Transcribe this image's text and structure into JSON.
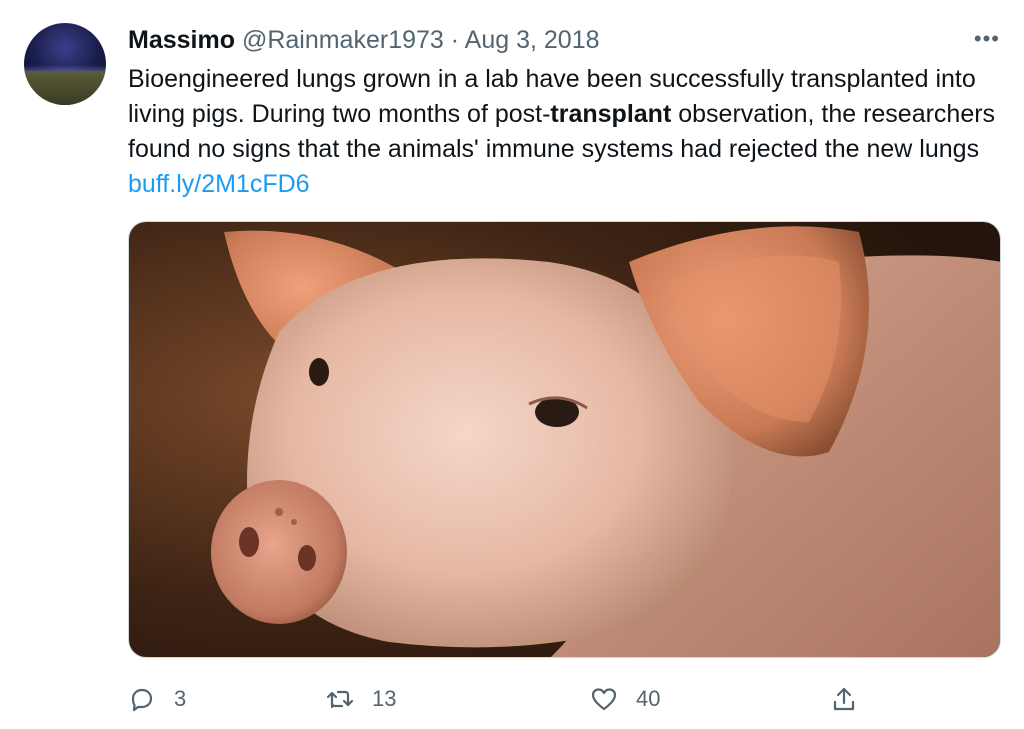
{
  "tweet": {
    "author_name": "Massimo",
    "author_handle": "@Rainmaker1973",
    "separator": "·",
    "date": "Aug 3, 2018",
    "more_label": "•••",
    "text_part1": "Bioengineered lungs grown in a lab have been successfully transplanted into living pigs. During two months of post-",
    "text_bold": "transplant",
    "text_part2": " observation, the researchers found no signs that the animals' immune systems had rejected the new lungs",
    "link_text": "buff.ly/2M1cFD6"
  },
  "actions": {
    "replies": "3",
    "retweets": "13",
    "likes": "40"
  },
  "icons": {
    "reply": "reply-icon",
    "retweet": "retweet-icon",
    "like": "heart-icon",
    "share": "share-icon",
    "more": "more-dots-icon"
  },
  "colors": {
    "link": "#1d9bf0",
    "secondary_text": "#536471",
    "primary_text": "#0f1419"
  }
}
